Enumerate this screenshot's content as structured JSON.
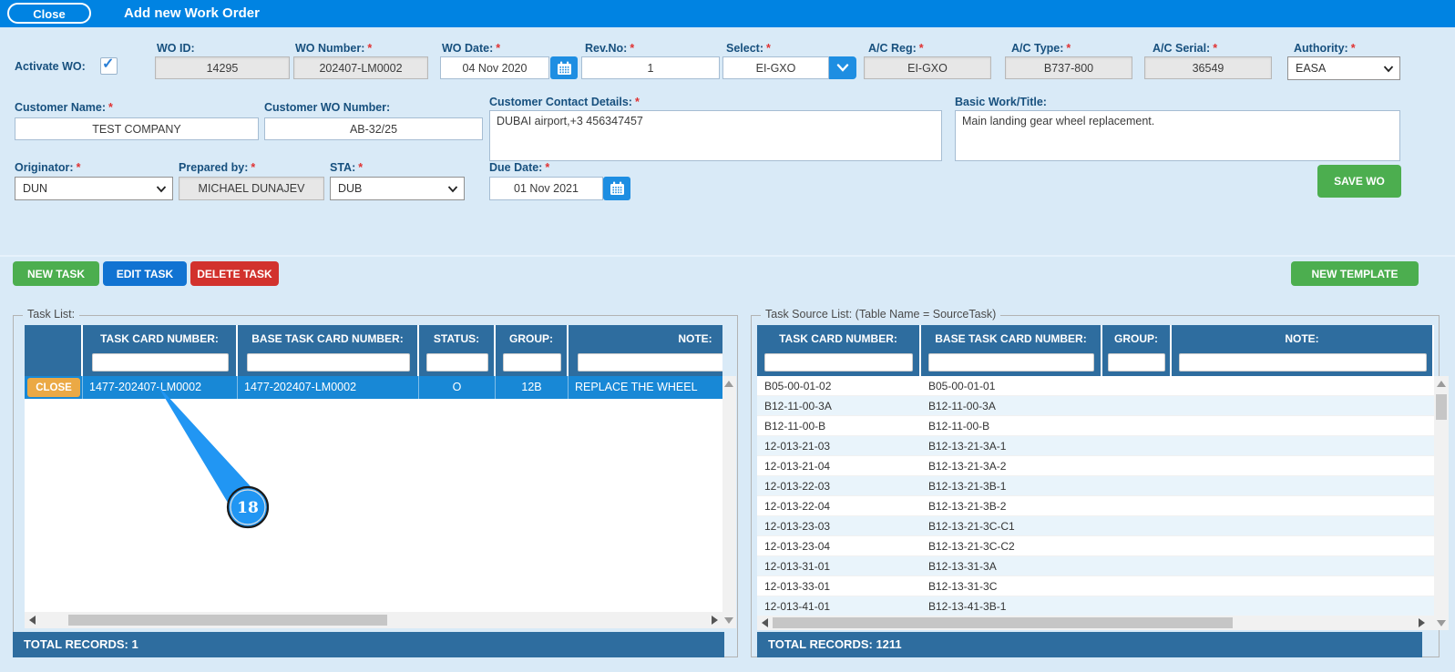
{
  "ui": {
    "req": "*",
    "check": "✓"
  },
  "topbar": {
    "close": "Close",
    "title": "Add new Work Order"
  },
  "form": {
    "activate": {
      "label": "Activate WO:",
      "checked": true
    },
    "wo_id": {
      "label": "WO ID:",
      "value": "14295"
    },
    "wo_number": {
      "label": "WO Number:",
      "value": "202407-LM0002"
    },
    "wo_date": {
      "label": "WO Date:",
      "value": "04 Nov 2020"
    },
    "rev_no": {
      "label": "Rev.No:",
      "value": "1"
    },
    "select": {
      "label": "Select:",
      "value": "EI-GXO"
    },
    "ac_reg": {
      "label": "A/C Reg:",
      "value": "EI-GXO"
    },
    "ac_type": {
      "label": "A/C Type:",
      "value": "B737-800"
    },
    "ac_serial": {
      "label": "A/C Serial:",
      "value": "36549"
    },
    "authority": {
      "label": "Authority:",
      "value": "EASA"
    },
    "customer_name": {
      "label": "Customer Name:",
      "value": "TEST COMPANY"
    },
    "customer_wo_number": {
      "label": "Customer WO Number:",
      "value": "AB-32/25"
    },
    "customer_contact": {
      "label": "Customer Contact Details:",
      "value": "DUBAI airport,+3 456347457"
    },
    "basic_work": {
      "label": "Basic Work/Title:",
      "value": "Main landing gear wheel replacement."
    },
    "originator": {
      "label": "Originator:",
      "value": "DUN"
    },
    "prepared_by": {
      "label": "Prepared by:",
      "value": "MICHAEL DUNAJEV"
    },
    "sta": {
      "label": "STA:",
      "value": "DUB"
    },
    "due_date": {
      "label": "Due Date:",
      "value": "01 Nov 2021"
    },
    "save_button": "SAVE WO"
  },
  "toolbar": {
    "new_task": "NEW TASK",
    "edit_task": "EDIT TASK",
    "delete_task": "DELETE TASK",
    "new_template": "NEW TEMPLATE"
  },
  "task_list": {
    "legend": "Task List:",
    "headers": {
      "card": "TASK CARD NUMBER:",
      "base": "BASE TASK CARD NUMBER:",
      "status": "STATUS:",
      "group": "GROUP:",
      "note": "NOTE:"
    },
    "row": {
      "action": "CLOSE",
      "card": "1477-202407-LM0002",
      "base": "1477-202407-LM0002",
      "status": "O",
      "group": "12B",
      "note": "REPLACE THE WHEEL"
    },
    "footer": "TOTAL RECORDS: 1"
  },
  "source_list": {
    "legend": "Task Source List: (Table Name = SourceTask)",
    "headers": {
      "card": "TASK CARD NUMBER:",
      "base": "BASE TASK CARD NUMBER:",
      "group": "GROUP:",
      "note": "NOTE:"
    },
    "rows": [
      {
        "card": "B05-00-01-02",
        "base": "B05-00-01-01",
        "group": "",
        "note": ""
      },
      {
        "card": "B12-11-00-3A",
        "base": "B12-11-00-3A",
        "group": "",
        "note": ""
      },
      {
        "card": "B12-11-00-B",
        "base": "B12-11-00-B",
        "group": "",
        "note": ""
      },
      {
        "card": "12-013-21-03",
        "base": "B12-13-21-3A-1",
        "group": "",
        "note": ""
      },
      {
        "card": "12-013-21-04",
        "base": "B12-13-21-3A-2",
        "group": "",
        "note": ""
      },
      {
        "card": "12-013-22-03",
        "base": "B12-13-21-3B-1",
        "group": "",
        "note": ""
      },
      {
        "card": "12-013-22-04",
        "base": "B12-13-21-3B-2",
        "group": "",
        "note": ""
      },
      {
        "card": "12-013-23-03",
        "base": "B12-13-21-3C-C1",
        "group": "",
        "note": ""
      },
      {
        "card": "12-013-23-04",
        "base": "B12-13-21-3C-C2",
        "group": "",
        "note": ""
      },
      {
        "card": "12-013-31-01",
        "base": "B12-13-31-3A",
        "group": "",
        "note": ""
      },
      {
        "card": "12-013-33-01",
        "base": "B12-13-31-3C",
        "group": "",
        "note": ""
      },
      {
        "card": "12-013-41-01",
        "base": "B12-13-41-3B-1",
        "group": "",
        "note": ""
      }
    ],
    "footer": "TOTAL RECORDS: 1211"
  },
  "annotation": {
    "number": "18"
  },
  "colors": {
    "topbar_blue": "#0083e2",
    "page_bg": "#d9eaf7",
    "table_header_blue": "#2e6d9f",
    "selected_row_blue": "#1888d6",
    "alt_row_blue": "#e9f4fb",
    "green_button": "#4cae4f",
    "blue_button": "#1173d2",
    "red_button": "#d2322d",
    "orange_row_button": "#eba945",
    "callout_blue": "#2196f3",
    "label_blue": "#17507e",
    "required_red": "#e03232"
  }
}
